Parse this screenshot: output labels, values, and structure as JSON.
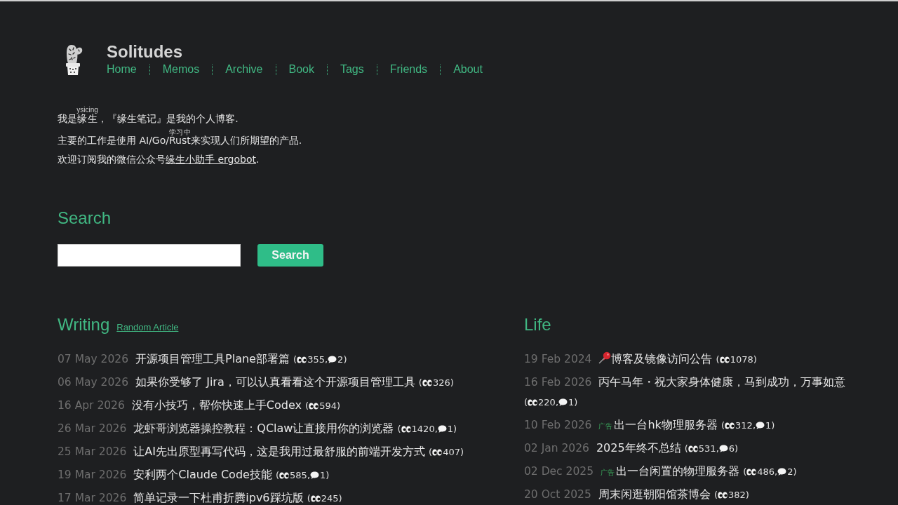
{
  "header": {
    "title": "Solitudes",
    "nav": [
      {
        "label": "Home"
      },
      {
        "label": "Memos"
      },
      {
        "label": "Archive"
      },
      {
        "label": "Book"
      },
      {
        "label": "Tags"
      },
      {
        "label": "Friends"
      },
      {
        "label": "About"
      }
    ]
  },
  "intro": {
    "lines": [
      [
        {
          "kind": "plain",
          "text": "我是"
        },
        {
          "kind": "ruby",
          "text": "缘生",
          "ruby": "ysicing"
        },
        {
          "kind": "plain",
          "text": "，『缘生笔记』是我的个人博客."
        }
      ],
      [
        {
          "kind": "plain",
          "text": "主要的工作是使用 AI/Go/"
        },
        {
          "kind": "ruby",
          "text": "Rust",
          "ruby": "学习中"
        },
        {
          "kind": "plain",
          "text": "来实现人们所期望的产品."
        }
      ],
      [
        {
          "kind": "plain",
          "text": "欢迎订阅我的微信公众号"
        },
        {
          "kind": "link",
          "text": "缘生小助手 ergobot"
        },
        {
          "kind": "plain",
          "text": "."
        }
      ]
    ]
  },
  "search": {
    "heading": "Search",
    "button": "Search"
  },
  "writing": {
    "heading": "Writing",
    "link": "Random Article",
    "posts": [
      {
        "date": "07 May 2026",
        "title": "开源项目管理工具Plane部署篇",
        "stats": {
          "open": "(",
          "views": "355",
          "separator": ",",
          "comments": "2",
          "close": ")"
        }
      },
      {
        "date": "06 May 2026",
        "title": "如果你受够了 Jira，可以认真看看这个开源项目管理工具",
        "stats": {
          "open": "(",
          "views": "326",
          "close": ")"
        }
      },
      {
        "date": "16 Apr 2026",
        "title": "没有小技巧，帮你快速上手Codex",
        "stats": {
          "open": "(",
          "views": "594",
          "close": ")"
        }
      },
      {
        "date": "26 Mar 2026",
        "title": "龙虾哥浏览器操控教程：QClaw让直接用你的浏览器",
        "stats": {
          "open": "(",
          "views": "1420",
          "separator": ",",
          "comments": "1",
          "close": ")"
        }
      },
      {
        "date": "25 Mar 2026",
        "title": "让AI先出原型再写代码，这是我用过最舒服的前端开发方式",
        "stats": {
          "open": "(",
          "views": "407",
          "close": ")"
        }
      },
      {
        "date": "19 Mar 2026",
        "title": "安利两个Claude Code技能",
        "stats": {
          "open": "(",
          "views": "585",
          "separator": ",",
          "comments": "1",
          "close": ")"
        }
      },
      {
        "date": "17 Mar 2026",
        "title": "简单记录一下杜甫折腾ipv6踩坑版",
        "stats": {
          "open": "(",
          "views": "245",
          "close": ")"
        }
      }
    ]
  },
  "life": {
    "heading": "Life",
    "posts": [
      {
        "date": "19 Feb 2024",
        "pinned": true,
        "title": "博客及镜像访问公告",
        "stats": {
          "open": "(",
          "views": "1078",
          "close": ")"
        }
      },
      {
        "date": "16 Feb 2026",
        "pinned": false,
        "title": "丙午马年・祝大家身体健康，马到成功，万事如意",
        "stats": {
          "open": "(",
          "views": "220",
          "separator": ",",
          "comments": "1",
          "close": ")"
        }
      },
      {
        "date": "10 Feb 2026",
        "pinned": false,
        "tag": "广告",
        "title": "出一台hk物理服务器",
        "stats": {
          "open": "(",
          "views": "312",
          "separator": ",",
          "comments": "1",
          "close": ")"
        }
      },
      {
        "date": "02 Jan 2026",
        "pinned": false,
        "title": "2025年终不总结",
        "stats": {
          "open": "(",
          "views": "531",
          "separator": ",",
          "comments": "6",
          "close": ")"
        }
      },
      {
        "date": "02 Dec 2025",
        "pinned": false,
        "tag": "广告",
        "title": "出一台闲置的物理服务器",
        "stats": {
          "open": "(",
          "views": "486",
          "separator": ",",
          "comments": "2",
          "close": ")"
        }
      },
      {
        "date": "20 Oct 2025",
        "pinned": false,
        "title": "周末闲逛朝阳馆茶博会",
        "stats": {
          "open": "(",
          "views": "382",
          "close": ")"
        }
      }
    ]
  }
}
